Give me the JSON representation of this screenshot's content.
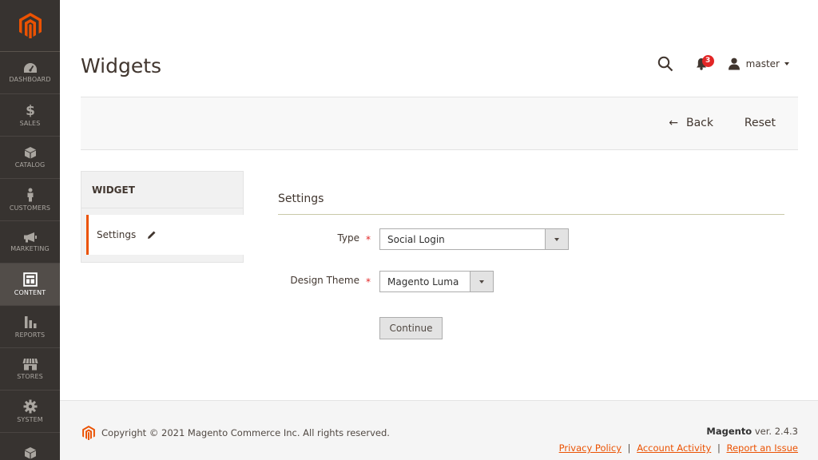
{
  "sidebar": {
    "logo": "magento-logo",
    "items": [
      {
        "label": "DASHBOARD",
        "icon": "dashboard-icon"
      },
      {
        "label": "SALES",
        "icon": "dollar-icon"
      },
      {
        "label": "CATALOG",
        "icon": "box-icon"
      },
      {
        "label": "CUSTOMERS",
        "icon": "person-icon"
      },
      {
        "label": "MARKETING",
        "icon": "megaphone-icon"
      },
      {
        "label": "CONTENT",
        "icon": "layout-icon",
        "active": true
      },
      {
        "label": "REPORTS",
        "icon": "bar-chart-icon"
      },
      {
        "label": "STORES",
        "icon": "storefront-icon"
      },
      {
        "label": "SYSTEM",
        "icon": "gear-icon"
      },
      {
        "label": "",
        "icon": "cube-icon"
      }
    ]
  },
  "header": {
    "title": "Widgets",
    "notification_count": "3",
    "user_name": "master"
  },
  "action_bar": {
    "back_label": "Back",
    "reset_label": "Reset"
  },
  "tabs": {
    "title": "WIDGET",
    "items": [
      {
        "label": "Settings"
      }
    ]
  },
  "form": {
    "fieldset_title": "Settings",
    "type_label": "Type",
    "type_value": "Social Login",
    "theme_label": "Design Theme",
    "theme_value": "Magento Luma",
    "required_mark": "*",
    "continue_label": "Continue"
  },
  "footer": {
    "copyright": "Copyright © 2021 Magento Commerce Inc. All rights reserved.",
    "brand": "Magento",
    "version": " ver. 2.4.3",
    "links": [
      "Privacy Policy",
      "Account Activity",
      "Report an Issue"
    ],
    "link_separator": "|"
  },
  "colors": {
    "sidebar_bg": "#373330",
    "accent": "#eb5202",
    "required": "#e22626"
  }
}
